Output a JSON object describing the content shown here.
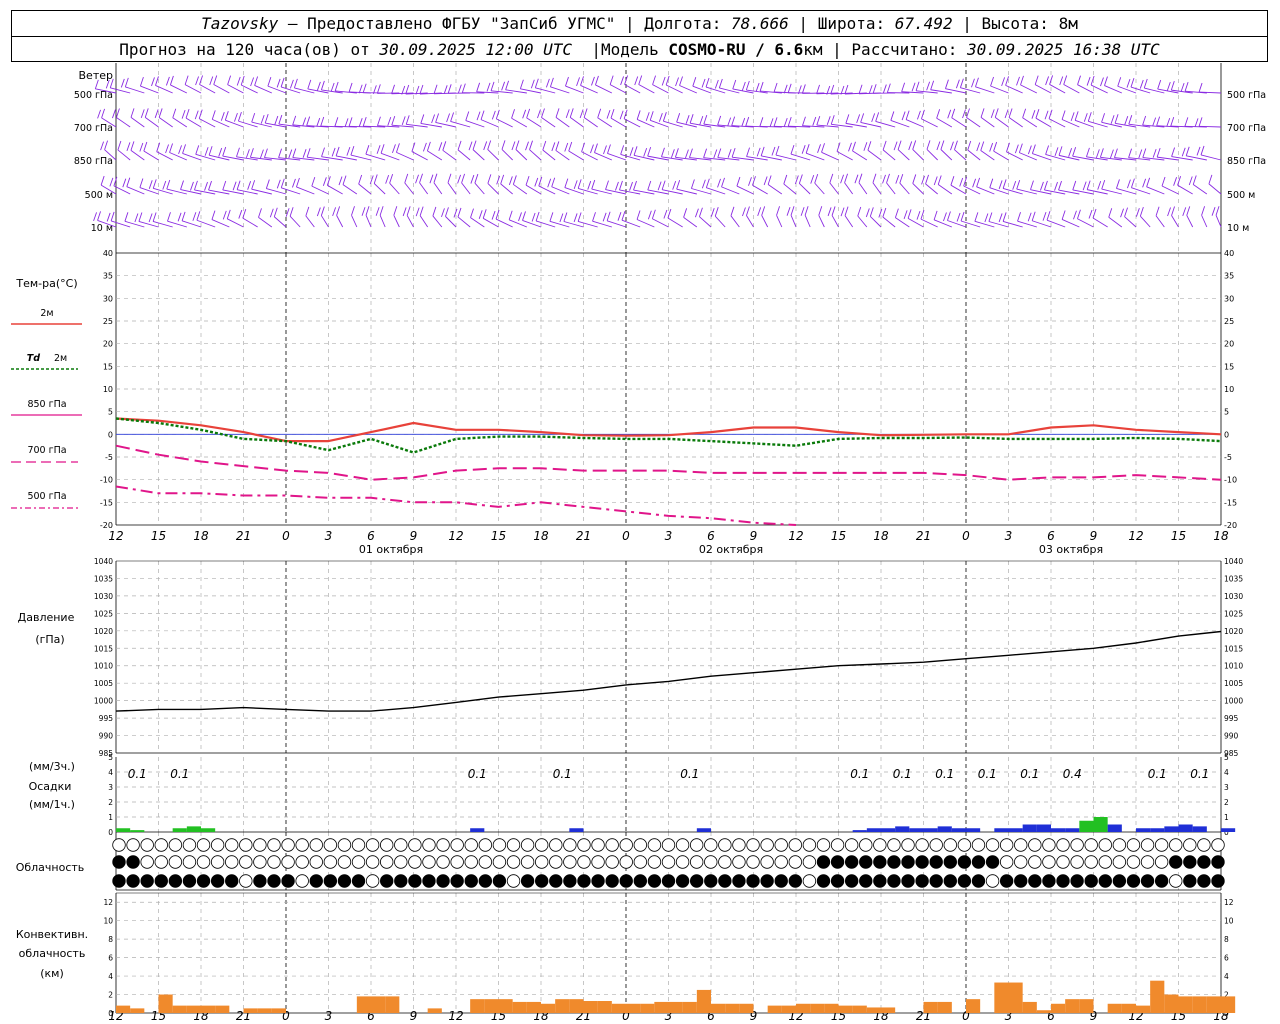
{
  "header": {
    "station": "Tazovsky",
    "provider": "– Предоставлено ФГБУ \"ЗапСиб УГМС\"",
    "lon_label": "Долгота:",
    "lon": "78.666",
    "lat_label": "Широта:",
    "lat": "67.492",
    "alt_label": "Высота:",
    "alt": "8м",
    "forecast_label": "Прогноз на 120 часа(ов) от",
    "issued": "30.09.2025 12:00 UTC",
    "model_label": "Модель",
    "model": "COSMO-RU / 6.6",
    "model_unit": "км",
    "calc_label": "Рассчитано:",
    "calc_time": "30.09.2025 16:38 UTC"
  },
  "labels": {
    "wind": "Ветер",
    "wind_levels": [
      "500 гПа",
      "700 гПа",
      "850 гПа",
      "500 м",
      "10 м"
    ],
    "temp_title": "Тем-ра(°C)",
    "t2m": "2м",
    "td": "Td",
    "td_level": "2м",
    "t850": "850 гПа",
    "t700": "700 гПа",
    "t500": "500 гПа",
    "pressure": "Давление",
    "pressure_unit": "(гПа)",
    "precip_unit_3h": "(мм/3ч.)",
    "precip": "Осадки",
    "precip_unit_1h": "(мм/1ч.)",
    "cloud": "Облачность",
    "conv1": "Конвективн.",
    "conv2": "облачность",
    "conv3": "(км)",
    "dates": [
      "01 октября",
      "02 октября",
      "03 октября"
    ],
    "hour_ticks": [
      "12",
      "15",
      "18",
      "21",
      "0",
      "3",
      "6",
      "9",
      "12",
      "15",
      "18",
      "21",
      "0",
      "3",
      "6",
      "9",
      "12",
      "15",
      "18",
      "21",
      "0",
      "3",
      "6",
      "9",
      "12",
      "15",
      "18"
    ]
  },
  "colors": {
    "t2m": "#e8423a",
    "td": "#0a7a0a",
    "t850": "#e0158a",
    "wind": "#8a2be2",
    "pressure": "#000000",
    "precip": "#1f2fd6",
    "precip_light": "#22c022",
    "conv": "#f08a2c"
  },
  "chart_data": [
    {
      "type": "line",
      "panel": "temperature",
      "ylim": [
        -20,
        40
      ],
      "x_hours_from_start": [
        0,
        3,
        6,
        9,
        12,
        15,
        18,
        21,
        24,
        27,
        30,
        33,
        36,
        39,
        42,
        45,
        48,
        51,
        54,
        57,
        60,
        63,
        66,
        69,
        72,
        75,
        78
      ],
      "series": [
        {
          "name": "2м",
          "values": [
            3.5,
            3,
            2,
            0.5,
            -1.5,
            -1.5,
            0.5,
            2.5,
            1,
            1,
            0.5,
            -0.2,
            -0.3,
            -0.2,
            0.5,
            1.5,
            1.5,
            0.5,
            -0.2,
            -0.1,
            0,
            0,
            1.5,
            2,
            1,
            0.5,
            0
          ]
        },
        {
          "name": "Td 2м",
          "values": [
            3.5,
            2.5,
            1,
            -1,
            -1.5,
            -3.5,
            -1,
            -4,
            -1,
            -0.5,
            -0.5,
            -0.8,
            -1,
            -1,
            -1.5,
            -2,
            -2.5,
            -1,
            -0.8,
            -0.8,
            -0.7,
            -1,
            -1,
            -1,
            -0.8,
            -1,
            -1.5
          ]
        },
        {
          "name": "850 гПа",
          "values": [
            -2.5,
            -4.5,
            -6,
            -7,
            -8,
            -8.5,
            -10,
            -9.5,
            -8,
            -7.5,
            -7.5,
            -8,
            -8,
            -8,
            -8.5,
            -8.5,
            -8.5,
            -8.5,
            -8.5,
            -8.5,
            -9,
            -10,
            -9.5,
            -9.5,
            -9,
            -9.5,
            -10
          ]
        },
        {
          "name": "500 гПа",
          "values": [
            -11.5,
            -13,
            -13,
            -13.5,
            -13.5,
            -14,
            -14,
            -15,
            -15,
            -16,
            -15,
            -16,
            -17,
            -18,
            -18.5,
            -19.5,
            -20,
            null,
            null,
            null,
            null,
            null,
            null,
            null,
            null,
            null,
            null
          ]
        }
      ]
    },
    {
      "type": "line",
      "panel": "pressure",
      "title": "Давление (гПа)",
      "ylim": [
        985,
        1040
      ],
      "x_hours_from_start": [
        0,
        3,
        6,
        9,
        12,
        15,
        18,
        21,
        24,
        27,
        30,
        33,
        36,
        39,
        42,
        45,
        48,
        51,
        54,
        57,
        60,
        63,
        66,
        69,
        72,
        75,
        78
      ],
      "series": [
        {
          "name": "Давление",
          "values": [
            997,
            997.5,
            997.5,
            998,
            997.5,
            997,
            997,
            998,
            999.5,
            1001,
            1002,
            1003,
            1004.5,
            1005.5,
            1007,
            1008,
            1009,
            1010,
            1010.5,
            1011,
            1012,
            1013,
            1014,
            1015,
            1016.5,
            1018.5,
            1019.8
          ]
        }
      ]
    },
    {
      "type": "bar",
      "panel": "precipitation",
      "ylim": [
        0,
        5
      ],
      "labeled_3h_totals_mm": [
        {
          "hour_from_start": 1.5,
          "value": "0.1"
        },
        {
          "hour_from_start": 4.5,
          "value": "0.1"
        },
        {
          "hour_from_start": 25.5,
          "value": "0.1"
        },
        {
          "hour_from_start": 31.5,
          "value": "0.1"
        },
        {
          "hour_from_start": 40.5,
          "value": "0.1"
        },
        {
          "hour_from_start": 52.5,
          "value": "0.1"
        },
        {
          "hour_from_start": 55.5,
          "value": "0.1"
        },
        {
          "hour_from_start": 58.5,
          "value": "0.1"
        },
        {
          "hour_from_start": 61.5,
          "value": "0.1"
        },
        {
          "hour_from_start": 64.5,
          "value": "0.1"
        },
        {
          "hour_from_start": 67.5,
          "value": "0.4"
        },
        {
          "hour_from_start": 73.5,
          "value": "0.1"
        },
        {
          "hour_from_start": 76.5,
          "value": "0.1"
        }
      ],
      "hourly_mm": [
        0.1,
        0.05,
        0,
        0,
        0.1,
        0.15,
        0.1,
        0,
        0,
        0,
        0,
        0,
        0,
        0,
        0,
        0,
        0,
        0,
        0,
        0,
        0,
        0,
        0,
        0,
        0,
        0.1,
        0,
        0,
        0,
        0,
        0,
        0,
        0.1,
        0,
        0,
        0,
        0,
        0,
        0,
        0,
        0,
        0.1,
        0,
        0,
        0,
        0,
        0,
        0,
        0,
        0,
        0,
        0,
        0.05,
        0.1,
        0.1,
        0.15,
        0.1,
        0.1,
        0.15,
        0.1,
        0.1,
        0,
        0.1,
        0.1,
        0.2,
        0.2,
        0.1,
        0.1,
        0.3,
        0.4,
        0.2,
        0,
        0.1,
        0.1,
        0.15,
        0.2,
        0.15,
        0,
        0.1
      ]
    },
    {
      "type": "bar",
      "panel": "convective_cloud",
      "ylim": [
        0,
        13
      ],
      "hourly_km": [
        0.8,
        0.5,
        0,
        2,
        0.8,
        0.8,
        0.8,
        0.8,
        0,
        0.5,
        0.5,
        0.5,
        0,
        0,
        0,
        0,
        0,
        1.8,
        1.8,
        1.8,
        0,
        0,
        0.5,
        0,
        0,
        1.5,
        1.5,
        1.5,
        1.2,
        1.2,
        1,
        1.5,
        1.5,
        1.3,
        1.3,
        1,
        1,
        1,
        1.2,
        1.2,
        1.2,
        2.5,
        1,
        1,
        1,
        0,
        0.8,
        0.8,
        1,
        1,
        1,
        0.8,
        0.8,
        0.6,
        0.6,
        0,
        0,
        1.2,
        1.2,
        0,
        1.5,
        0,
        3.3,
        3.3,
        1.2,
        0.3,
        1,
        1.5,
        1.5,
        0,
        1,
        1,
        0.8,
        3.5,
        2,
        1.8,
        1.8,
        1.8,
        1.8
      ]
    }
  ]
}
